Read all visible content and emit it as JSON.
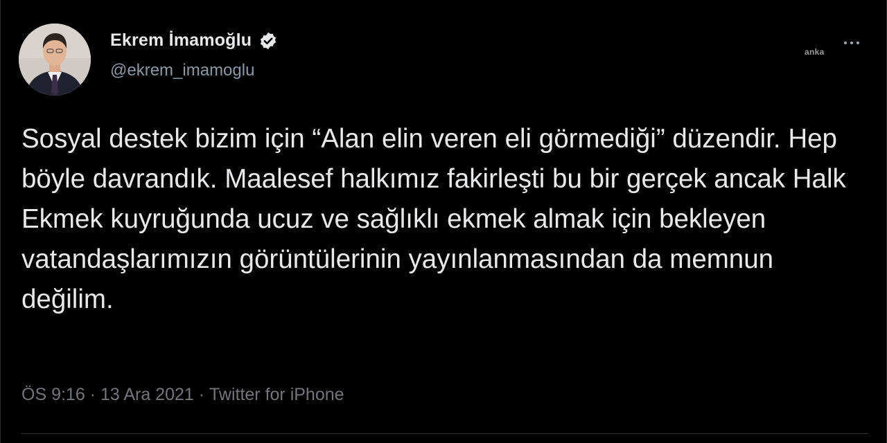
{
  "tweet": {
    "author": {
      "display_name": "Ekrem İmamoğlu",
      "handle": "@ekrem_imamoglu",
      "verified_icon": "verified-badge-icon"
    },
    "text": "Sosyal destek bizim için “Alan elin veren eli görmediği” düzendir. Hep böyle davrandık. Maalesef halkımız fakirleşti bu bir gerçek ancak Halk Ekmek kuyruğunda ucuz ve sağlıklı ekmek almak için bekleyen vatandaşlarımızın görüntülerinin yayınlanmasından da memnun değilim.",
    "time": "ÖS 9:16",
    "separator": " · ",
    "date": "13 Ara 2021",
    "source": "Twitter for iPhone",
    "more_icon": "more-options-icon"
  },
  "watermark": "anka",
  "colors": {
    "background": "#000000",
    "text_primary": "#e7e9ea",
    "text_secondary": "#8b98a5",
    "meta": "#72767b",
    "verified": "#e7e9ea"
  }
}
